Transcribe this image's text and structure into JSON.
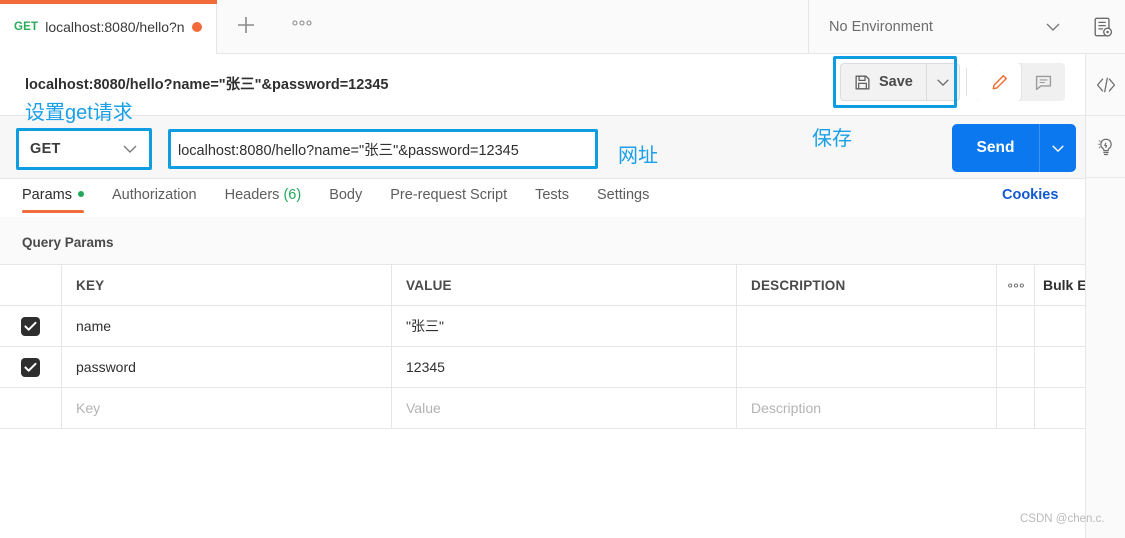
{
  "tabbar": {
    "active_tab": {
      "method": "GET",
      "title": "localhost:8080/hello?n",
      "unsaved_dot": "●"
    },
    "new_tab_label": "+",
    "more_label": "ooo",
    "environment": {
      "selected": "No Environment",
      "caret": "⌄"
    },
    "env_quick_look_icon": "environment-quick-look-icon"
  },
  "request": {
    "title": "localhost:8080/hello?name=\"张三\"&password=12345",
    "save_label": "Save",
    "save_caret": "⌄",
    "method": "GET",
    "method_caret": "⌄",
    "url": "localhost:8080/hello?name=\"张三\"&password=12345",
    "send_label": "Send",
    "send_caret": "⌄"
  },
  "req_tabs": [
    {
      "label": "Params",
      "active": true,
      "dot": true
    },
    {
      "label": "Authorization",
      "active": false
    },
    {
      "label": "Headers",
      "count": "(6)",
      "active": false
    },
    {
      "label": "Body",
      "active": false
    },
    {
      "label": "Pre-request Script",
      "active": false
    },
    {
      "label": "Tests",
      "active": false
    },
    {
      "label": "Settings",
      "active": false
    }
  ],
  "cookies_link": "Cookies",
  "query_params": {
    "section_label": "Query Params",
    "columns": {
      "key": "KEY",
      "value": "VALUE",
      "description": "DESCRIPTION"
    },
    "options_dots": "ooo",
    "bulk_edit": "Bulk Edit",
    "rows": [
      {
        "checked": true,
        "key": "name",
        "value": "\"张三\"",
        "description": ""
      },
      {
        "checked": true,
        "key": "password",
        "value": "12345",
        "description": ""
      }
    ],
    "placeholder_row": {
      "key": "Key",
      "value": "Value",
      "description": "Description"
    }
  },
  "annotations": [
    {
      "text": "设置get请求",
      "meaning": "set-get-request"
    },
    {
      "text": "网址",
      "meaning": "url"
    },
    {
      "text": "保存",
      "meaning": "save"
    }
  ],
  "watermark": "CSDN @chen.c.",
  "colors": {
    "accent_orange": "#f26b3a",
    "send_blue": "#0b78f0",
    "annotation_blue": "#0d9de0",
    "green": "#21a95a",
    "link_blue": "#1359d1"
  }
}
